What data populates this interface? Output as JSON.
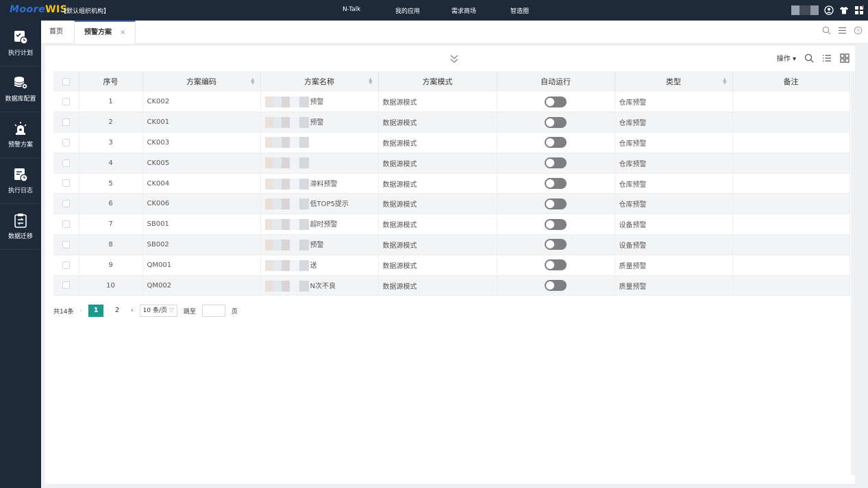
{
  "topbar": {
    "logo_part1": "Moore",
    "logo_part2": "WIS",
    "org": "【默认组织机构】",
    "nav": [
      "N-Talk",
      "我的应用",
      "需求商场",
      "智造圈"
    ]
  },
  "sidebar": {
    "items": [
      {
        "label": "执行计划",
        "icon": "plan-clock-icon"
      },
      {
        "label": "数据库配置",
        "icon": "database-gear-icon"
      },
      {
        "label": "预警方案",
        "icon": "alarm-light-icon"
      },
      {
        "label": "执行日志",
        "icon": "log-clock-icon"
      },
      {
        "label": "数据迁移",
        "icon": "clipboard-migrate-icon"
      }
    ]
  },
  "tabs": {
    "home": "首页",
    "active": "预警方案",
    "close": "×"
  },
  "toolbar": {
    "ops_label": "操作"
  },
  "table": {
    "headers": [
      "序号",
      "方案编码",
      "方案名称",
      "方案模式",
      "自动运行",
      "类型",
      "备注"
    ],
    "rows": [
      {
        "no": "1",
        "code": "CK002",
        "name": "预警",
        "mode": "数据源模式",
        "type": "仓库预警",
        "remark": ""
      },
      {
        "no": "2",
        "code": "CK001",
        "name": "预警",
        "mode": "数据源模式",
        "type": "仓库预警",
        "remark": ""
      },
      {
        "no": "3",
        "code": "CK003",
        "name": "",
        "mode": "数据源模式",
        "type": "仓库预警",
        "remark": ""
      },
      {
        "no": "4",
        "code": "CK005",
        "name": "",
        "mode": "数据源模式",
        "type": "仓库预警",
        "remark": ""
      },
      {
        "no": "5",
        "code": "CK004",
        "name": "滞料预警",
        "mode": "数据源模式",
        "type": "仓库预警",
        "remark": ""
      },
      {
        "no": "6",
        "code": "CK006",
        "name": "低TOP5提示",
        "mode": "数据源模式",
        "type": "仓库预警",
        "remark": ""
      },
      {
        "no": "7",
        "code": "SB001",
        "name": "超时预警",
        "mode": "数据源模式",
        "type": "设备预警",
        "remark": ""
      },
      {
        "no": "8",
        "code": "SB002",
        "name": "预警",
        "mode": "数据源模式",
        "type": "设备预警",
        "remark": ""
      },
      {
        "no": "9",
        "code": "QM001",
        "name": "送",
        "mode": "数据源模式",
        "type": "质量预警",
        "remark": ""
      },
      {
        "no": "10",
        "code": "QM002",
        "name": "N次不良",
        "mode": "数据源模式",
        "type": "质量预警",
        "remark": ""
      }
    ]
  },
  "pager": {
    "total": "共14条",
    "pages": [
      "1",
      "2"
    ],
    "current": "1",
    "page_size": "10 条/页",
    "jump_label": "跳至",
    "page_suffix": "页"
  }
}
